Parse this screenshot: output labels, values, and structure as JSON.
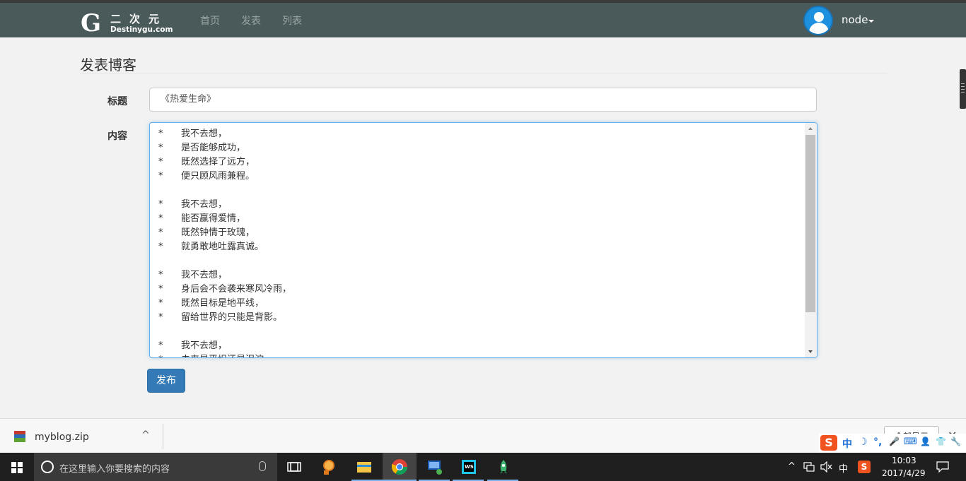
{
  "navbar": {
    "logo_glyph": "G",
    "logo_cn": "二次元",
    "logo_en": "Destinygu.com",
    "links": [
      "首页",
      "发表",
      "列表"
    ],
    "user": "node"
  },
  "page": {
    "title": "发表博客",
    "title_label": "标题",
    "title_value": "《热爱生命》",
    "content_label": "内容",
    "content_lines": [
      {
        "star": "*",
        "text": "我不去想，"
      },
      {
        "star": "*",
        "text": "是否能够成功，"
      },
      {
        "star": "*",
        "text": "既然选择了远方，"
      },
      {
        "star": "*",
        "text": "便只顾风雨兼程。"
      },
      {
        "star": "",
        "text": ""
      },
      {
        "star": "*",
        "text": "我不去想，"
      },
      {
        "star": "*",
        "text": "能否赢得爱情，"
      },
      {
        "star": "*",
        "text": "既然钟情于玫瑰，"
      },
      {
        "star": "*",
        "text": "就勇敢地吐露真诚。"
      },
      {
        "star": "",
        "text": ""
      },
      {
        "star": "*",
        "text": "我不去想，"
      },
      {
        "star": "*",
        "text": "身后会不会袭来寒风冷雨，"
      },
      {
        "star": "*",
        "text": "既然目标是地平线，"
      },
      {
        "star": "*",
        "text": "留给世界的只能是背影。"
      },
      {
        "star": "",
        "text": ""
      },
      {
        "star": "*",
        "text": "我不去想，"
      },
      {
        "star": "*",
        "text": "未来是平坦还是泥泞，"
      }
    ],
    "submit_label": "发布"
  },
  "downloads": {
    "file_name": "myblog.zip",
    "chevron": "^",
    "show_all": "全部显示",
    "close": "✕"
  },
  "ime": {
    "logo": "S",
    "items": [
      "中",
      "☽",
      "°,",
      "🎤",
      "⌨",
      "👤",
      "👕",
      "🔧"
    ]
  },
  "taskbar": {
    "search_placeholder": "在这里输入你要搜索的内容",
    "tray_lang": "中",
    "time": "10:03",
    "date": "2017/4/29"
  }
}
